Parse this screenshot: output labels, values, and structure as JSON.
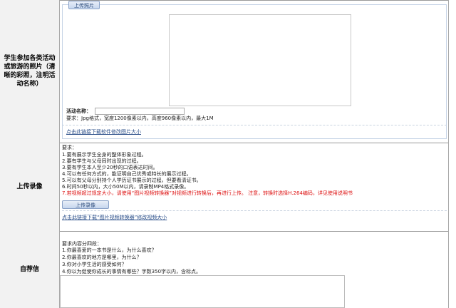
{
  "rows": {
    "photo": {
      "label": "学生参加各类活动或旅游的照片（清晰的彩照，注明活动名称）",
      "upload_button": "上传照片",
      "activity_label": "活动名称：",
      "requirement": "要求：Jpg格式，宽度1200像素以内，高度960像素以内，最大1M",
      "resize_link": "点击此链接下载软件修改图片大小"
    },
    "video": {
      "label": "上传录像",
      "req_title": "要求：",
      "reqs": [
        "1.要有展示学生全身的整体形象过程。",
        "2.要有学生与父母同时出现的过程。",
        "3.要有学生本人至少20秒的口语表达时间。",
        "4.可以有任何方式的，能证明自己优秀或特长的展示过程。",
        "5.可以有父母分别持个人学历证书展示的过程，但要看清证书。",
        "6.时间50秒以内，大小50M以内，请录制MP4格式录像。"
      ],
      "warning": "7.若视频超过规定大小，请使用“图片视频转换器”对视频进行转换后，再进行上传。 注意，转换时选择H.264编码，详见使用说明书",
      "upload_button": "上传录像",
      "convert_link": "点击此链接下载“图片视频转换器”修改视频大小"
    },
    "letter": {
      "label": "自荐信",
      "req_title": "要求内容分四段：",
      "reqs": [
        "1.你最喜爱的一本书是什么，为什么喜欢？",
        "2.你最喜欢的地方是哪里，为什么？",
        "3.你对小学生活的感受如何？",
        "4.你以为促使你成长的事情有哪些？字数350字以内，含标点。"
      ]
    }
  }
}
